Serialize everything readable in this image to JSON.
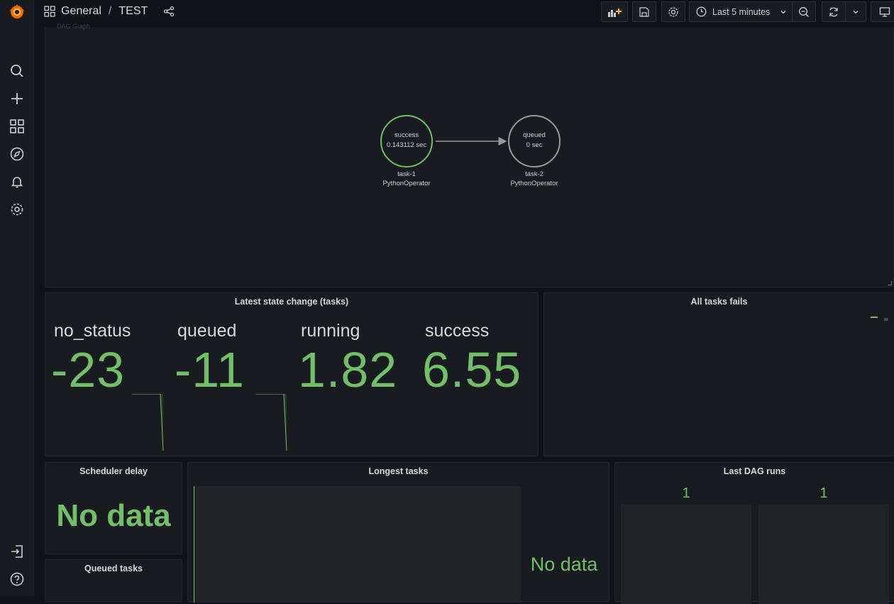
{
  "breadcrumb": {
    "folder": "General",
    "separator": "/",
    "dashboard": "TEST"
  },
  "toolbar": {
    "time_range": "Last 5 minutes"
  },
  "graph_panel": {
    "hidden_title": "DAG Graph",
    "nodes": [
      {
        "state": "success",
        "duration": "0.143112 sec",
        "task": "task-1",
        "operator": "PythonOperator"
      },
      {
        "state": "queued",
        "duration": "0 sec",
        "task": "task-2",
        "operator": "PythonOperator"
      }
    ]
  },
  "state_panel": {
    "title": "Latest state change (tasks)",
    "stats": [
      {
        "label": "no_status",
        "value": "-23"
      },
      {
        "label": "queued",
        "value": "-11"
      },
      {
        "label": "running",
        "value": "1.82"
      },
      {
        "label": "success",
        "value": "6.55"
      }
    ]
  },
  "fails_panel": {
    "title": "All tasks fails"
  },
  "scheduler_panel": {
    "title": "Scheduler delay",
    "value": "No data"
  },
  "queued_panel": {
    "title": "Queued tasks"
  },
  "longest_panel": {
    "title": "Longest tasks",
    "value": "No data"
  },
  "dagruns_panel": {
    "title": "Last DAG runs",
    "values": [
      "1",
      "1"
    ]
  },
  "colors": {
    "accent_green": "#73bf69",
    "node_gray": "#9b9b9b",
    "bg": "#111217",
    "panel": "#181b1f"
  }
}
